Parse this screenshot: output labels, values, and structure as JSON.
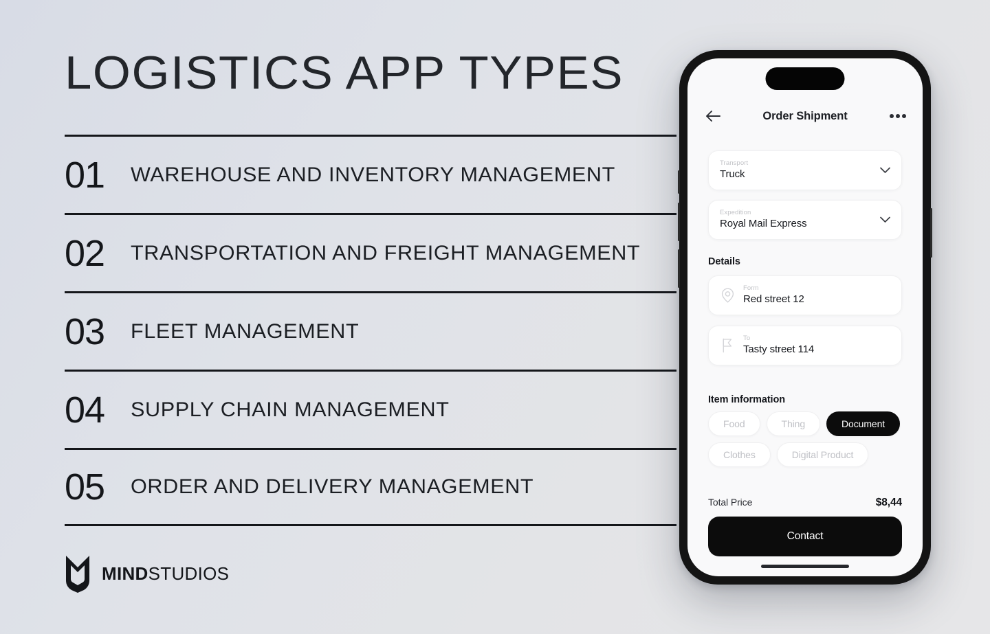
{
  "slide": {
    "title": "LOGISTICS APP TYPES",
    "items": [
      {
        "num": "01",
        "label": "WAREHOUSE AND INVENTORY MANAGEMENT"
      },
      {
        "num": "02",
        "label": "TRANSPORTATION AND FREIGHT MANAGEMENT"
      },
      {
        "num": "03",
        "label": "FLEET MANAGEMENT"
      },
      {
        "num": "04",
        "label": "SUPPLY CHAIN MANAGEMENT"
      },
      {
        "num": "05",
        "label": "ORDER AND DELIVERY MANAGEMENT"
      }
    ],
    "logo": {
      "mark": "mind-studios-shield-icon",
      "name_bold": "MIND",
      "name_regular": "STUDIOS"
    }
  },
  "phone": {
    "nav": {
      "back_icon": "arrow-left-icon",
      "title": "Order Shipment",
      "more_icon": "more-horizontal-icon"
    },
    "selects": [
      {
        "label": "Transport",
        "value": "Truck",
        "chevron_icon": "chevron-down-icon"
      },
      {
        "label": "Expedition",
        "value": "Royal Mail Express",
        "chevron_icon": "chevron-down-icon"
      }
    ],
    "details": {
      "heading": "Details",
      "fields": [
        {
          "label": "Form",
          "value": "Red street 12",
          "icon": "map-pin-icon"
        },
        {
          "label": "To",
          "value": "Tasty street 114",
          "icon": "flag-icon"
        }
      ]
    },
    "item_information": {
      "heading": "Item information",
      "chips": [
        {
          "label": "Food",
          "selected": false
        },
        {
          "label": "Thing",
          "selected": false
        },
        {
          "label": "Document",
          "selected": true
        },
        {
          "label": "Clothes",
          "selected": false
        },
        {
          "label": "Digital Product",
          "selected": false
        }
      ]
    },
    "total": {
      "label": "Total Price",
      "value": "$8,44"
    },
    "cta": {
      "label": "Contact"
    }
  },
  "colors": {
    "ink": "#14161a",
    "accent_dark": "#0c0c0c",
    "muted": "#bfc0c5",
    "bg_start": "#d8dce6",
    "bg_end": "#e6e6e8"
  }
}
